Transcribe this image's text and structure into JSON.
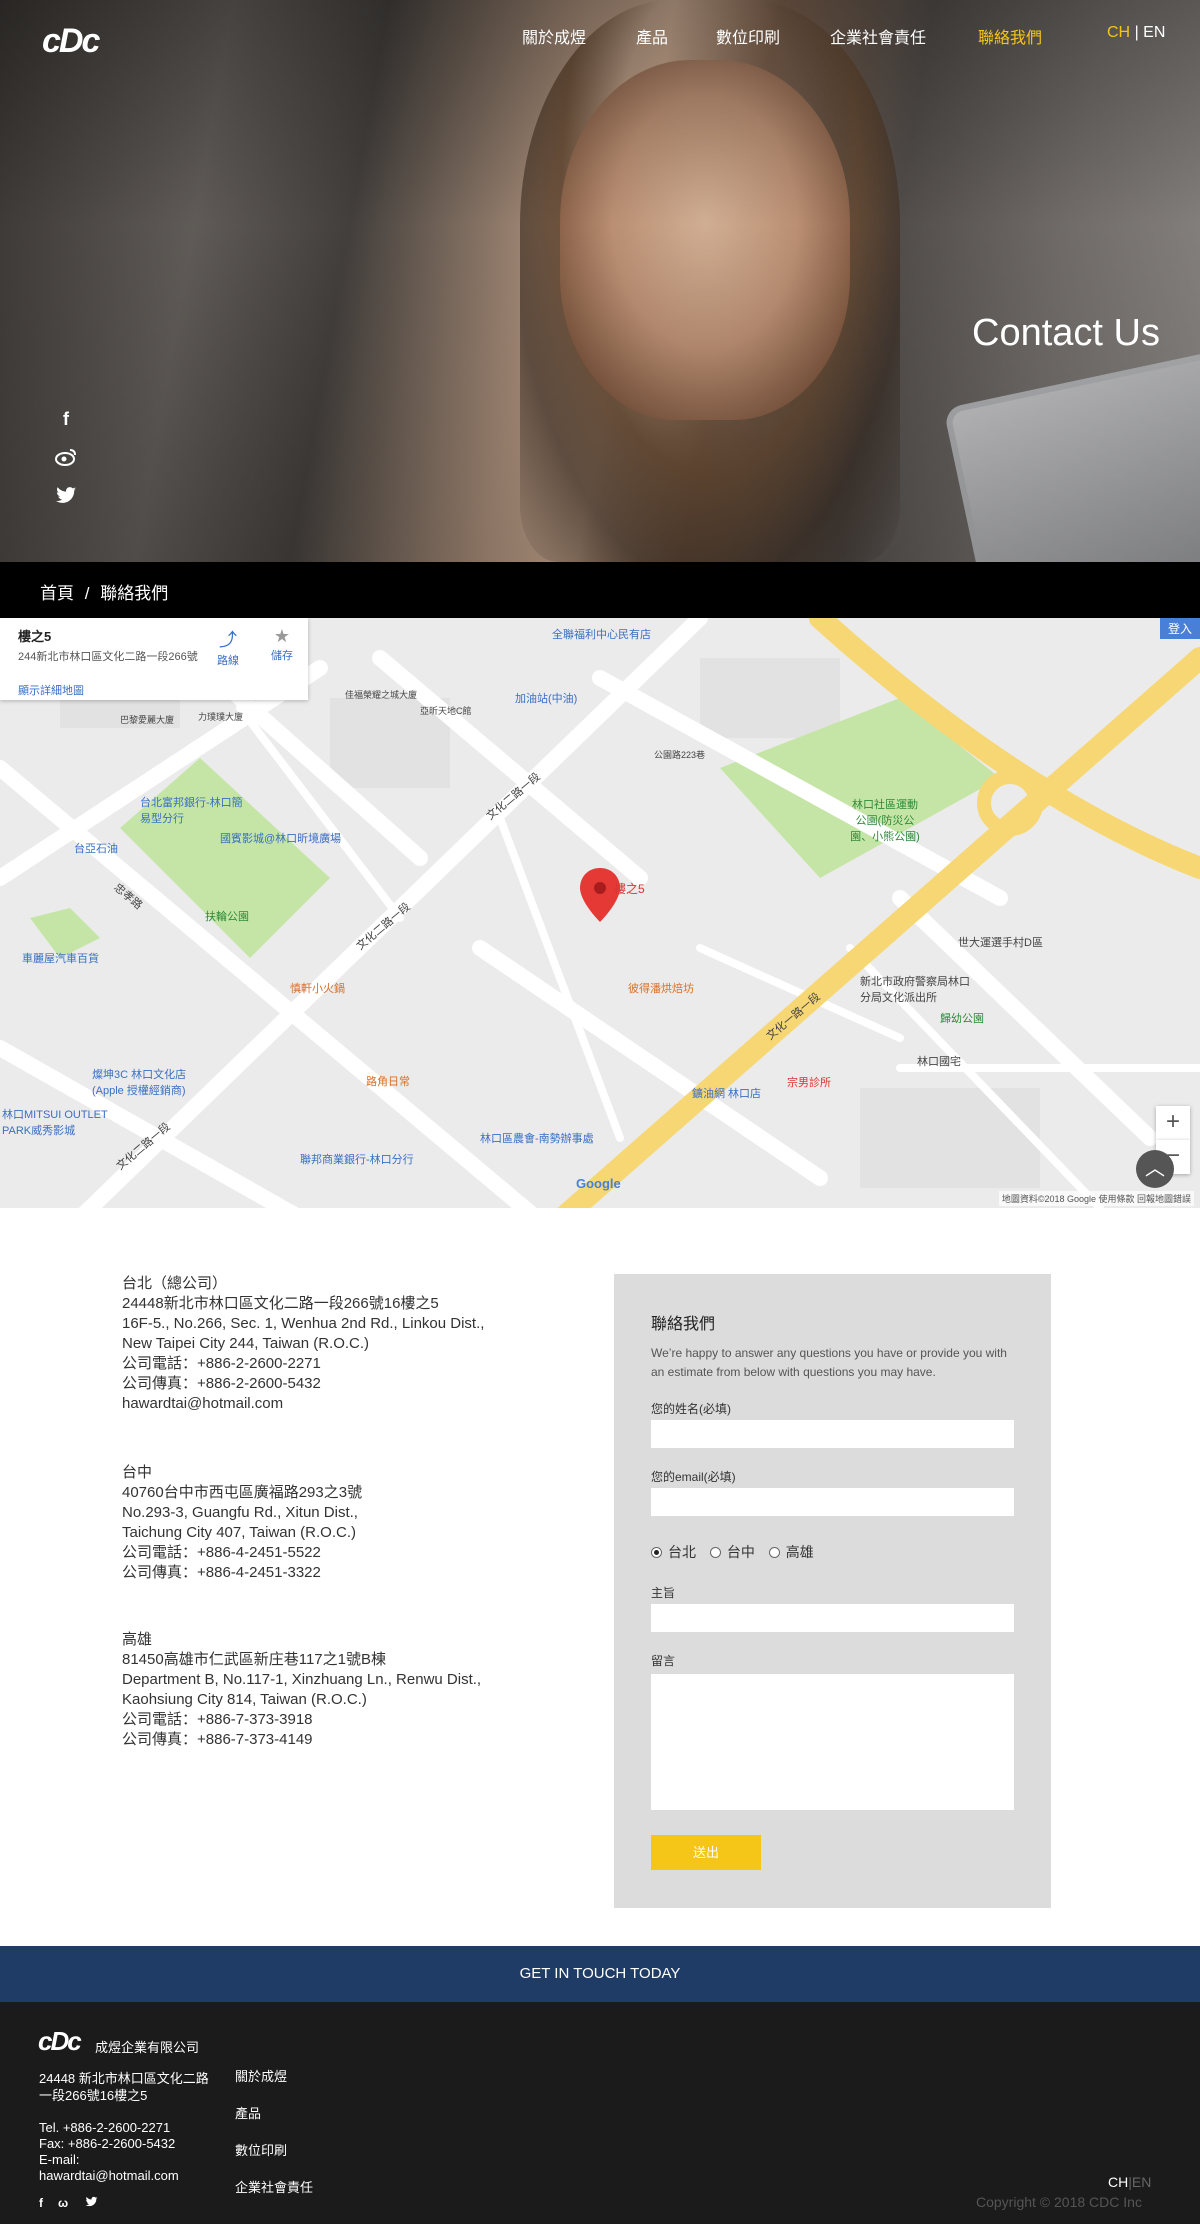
{
  "nav": {
    "logo": "cDc",
    "items": [
      "關於成煜",
      "產品",
      "數位印刷",
      "企業社會責任",
      "聯絡我們"
    ],
    "active_index": 4,
    "lang_ch": "CH",
    "lang_sep": "|",
    "lang_en": "EN"
  },
  "hero": {
    "title": "Contact Us",
    "social_icons": [
      "facebook-icon",
      "weibo-icon",
      "twitter-icon"
    ]
  },
  "breadcrumb": {
    "home": "首頁",
    "separator": "/",
    "current": "聯絡我們"
  },
  "map": {
    "card_title": "樓之5",
    "card_address": "244新北市林口區文化二路一段266號",
    "directions_label": "路線",
    "save_label": "儲存",
    "larger_map_link": "顯示詳細地圖",
    "login_label": "登入",
    "pin_label": "樓之5",
    "google_label": "Google",
    "footer_text": "地圖資料©2018 Google   使用條款   回報地圖錯誤",
    "labels": {
      "fulihe": "全聯福利中心民有店",
      "tiyu": "林口社區運動公園(防災公園、小熊公園)",
      "fuhe": "扶輪公園",
      "guobin": "國賓影城@林口昕境廣場",
      "taibei_fubang": "台北富邦銀行-林口簡易型分行",
      "taiya": "台亞石油",
      "shiliuqiao": "中油",
      "jiayou": "加油站(中油)",
      "wenhua_er": "文化二路一段",
      "wenhua_er_b": "文化二路一段",
      "wenhua_er_c": "文化二路一段",
      "wenhua_yi": "文化一路一段",
      "zhongxiao": "忠孝路",
      "zhenxuan": "慎軒小火鍋",
      "bihu": "彼得潘烘焙坊",
      "lukou": "路角日常",
      "xinbei_police": "新北市政府警察局林口分局文化派出所",
      "gui_you": "歸幼公園",
      "linkou_guozhai": "林口國宅",
      "zongnan": "宗男診所",
      "yanyou": "鑛油網 林口店",
      "nonghui": "林口區農會-南勢辦事處",
      "lianbang": "聯邦商業銀行-林口分行",
      "mitsui": "林口MITSUI OUTLET PARK威秀影城",
      "yan3c": "燦坤3C 林口文化店(Apple 授權經銷商)",
      "cheli": "車麗屋汽車百貨",
      "shijie": "世大運選手村D區",
      "gongyuan": "公園路",
      "gongyuan223": "公園路223巷",
      "bajiafu": "巴黎愛麗大廈",
      "lijuan": "力璞璞大廈",
      "jia_qu": "佳福榮耀之城大廈",
      "yixin": "亞昕天地C館"
    }
  },
  "offices": [
    {
      "name": "台北（總公司）",
      "lines": [
        "24448新北市林口區文化二路一段266號16樓之5",
        "16F-5., No.266, Sec. 1, Wenhua 2nd Rd., Linkou Dist.,",
        "New Taipei City 244, Taiwan (R.O.C.)",
        "公司電話：+886-2-2600-2271",
        "公司傳真：+886-2-2600-5432",
        "hawardtai@hotmail.com"
      ]
    },
    {
      "name": "台中",
      "lines": [
        "40760台中市西屯區廣福路293之3號",
        "No.293-3, Guangfu Rd., Xitun Dist.,",
        "Taichung City 407, Taiwan (R.O.C.)",
        "公司電話：+886-4-2451-5522",
        "公司傳真：+886-4-2451-3322"
      ]
    },
    {
      "name": "高雄",
      "lines": [
        "81450高雄市仁武區新庄巷117之1號B棟",
        "Department B, No.117-1, Xinzhuang Ln., Renwu Dist.,",
        "Kaohsiung City 814, Taiwan (R.O.C.)",
        "公司電話：+886-7-373-3918",
        "公司傳真：+886-7-373-4149"
      ]
    }
  ],
  "form": {
    "title": "聯絡我們",
    "subtitle": "We’re happy to answer any questions you have or provide you with an estimate from below with questions you may have.",
    "name_label": "您的姓名(必填)",
    "email_label": "您的email(必填)",
    "radio_options": [
      "台北",
      "台中",
      "高雄"
    ],
    "radio_selected": 0,
    "subject_label": "主旨",
    "message_label": "留言",
    "submit_label": "送出"
  },
  "cta": {
    "label": "GET IN TOUCH TODAY"
  },
  "footer": {
    "logo": "cDc",
    "company": "成煜企業有限公司",
    "address": "24448 新北市林口區文化二路一段266號16樓之5",
    "tel": "Tel. +886-2-2600-2271",
    "fax": "Fax: +886-2-2600-5432",
    "email_label": "E-mail:",
    "email": "hawardtai@hotmail.com",
    "nav": [
      "關於成煜",
      "產品",
      "數位印刷",
      "企業社會責任"
    ],
    "lang_ch": "CH",
    "lang_sep": "|",
    "lang_en": "EN",
    "copyright": "Copyright © 2018 CDC Inc"
  }
}
